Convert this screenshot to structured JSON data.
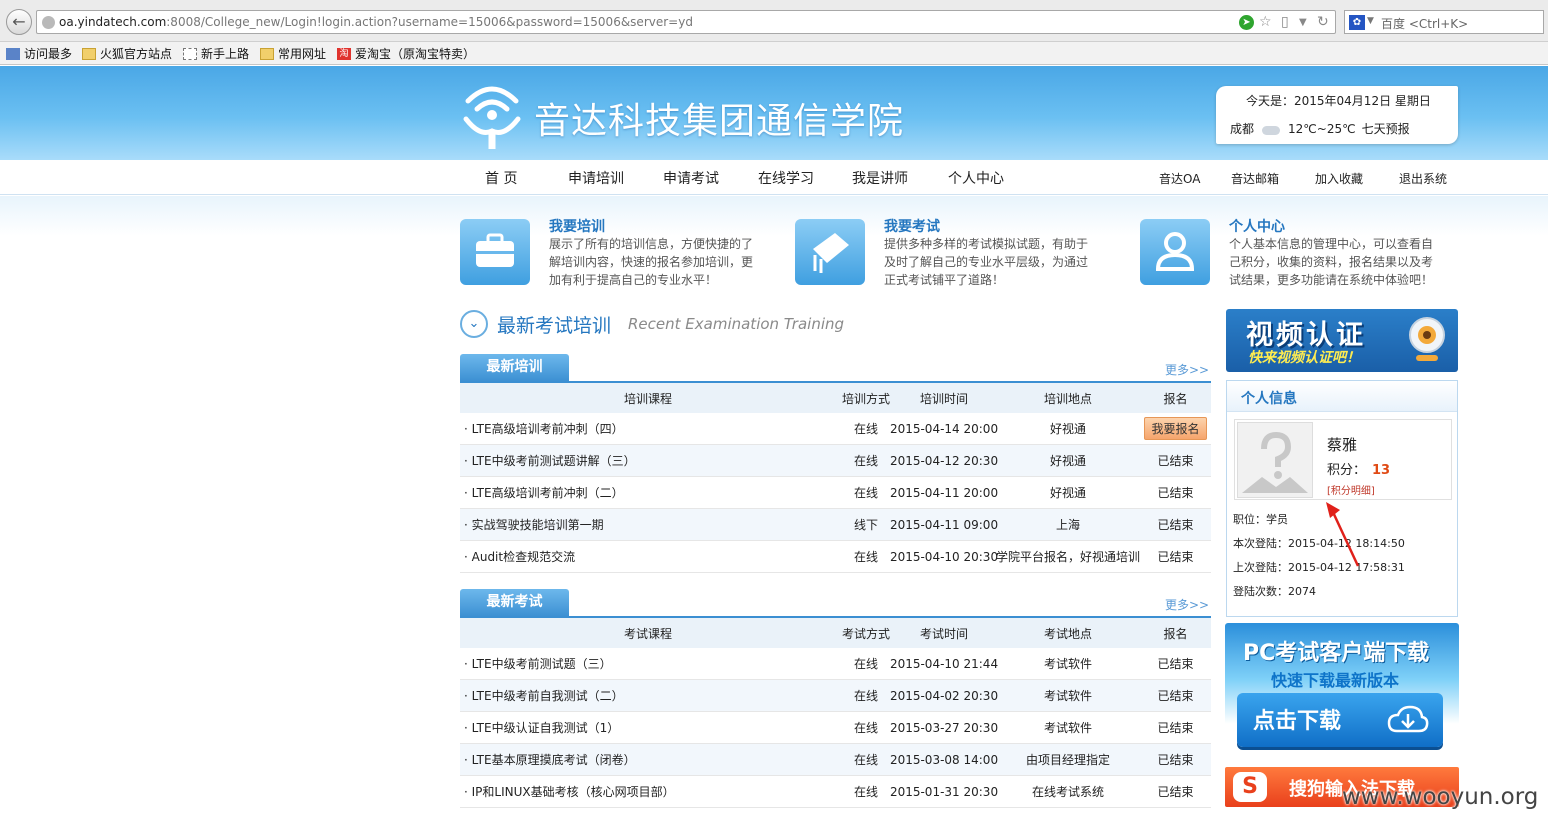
{
  "browser": {
    "url_domain": "oa.yindatech.com",
    "url_rest": ":8008/College_new/Login!login.action?username=15006&password=15006&server=yd",
    "search_placeholder": "百度 <Ctrl+K>",
    "bookmarks": [
      "访问最多",
      "火狐官方站点",
      "新手上路",
      "常用网址",
      "爱淘宝（原淘宝特卖）"
    ]
  },
  "header": {
    "site_title": "音达科技集团通信学院",
    "weather": {
      "date_line": "今天是：2015年04月12日 星期日",
      "city": "成都",
      "temp": "12℃~25℃",
      "forecast_link": "七天预报"
    }
  },
  "nav": {
    "main": [
      "首 页",
      "申请培训",
      "申请考试",
      "在线学习",
      "我是讲师",
      "个人中心"
    ],
    "sub": [
      "音达OA",
      "音达邮箱",
      "加入收藏",
      "退出系统"
    ]
  },
  "features": [
    {
      "title": "我要培训",
      "desc": "展示了所有的培训信息，方便快捷的了解培训内容，快速的报名参加培训，更加有利于提高自己的专业水平！"
    },
    {
      "title": "我要考试",
      "desc": "提供多种多样的考试模拟试题，有助于及时了解自己的专业水平层级，为通过正式考试铺平了道路！"
    },
    {
      "title": "个人中心",
      "desc": "个人基本信息的管理中心，可以查看自己积分，收集的资料，报名结果以及考试结果，更多功能请在系统中体验吧！"
    }
  ],
  "section": {
    "title": "最新考试培训",
    "subtitle": "Recent Examination Training"
  },
  "training": {
    "tab": "最新培训",
    "more": "更多>>",
    "headers": [
      "培训课程",
      "培训方式",
      "培训时间",
      "培训地点",
      "报名"
    ],
    "rows": [
      {
        "course": "· LTE高级培训考前冲刺（四）",
        "mode": "在线",
        "time": "2015-04-14 20:00",
        "place": "好视通",
        "action": "我要报名"
      },
      {
        "course": "· LTE中级考前测试题讲解（三）",
        "mode": "在线",
        "time": "2015-04-12 20:30",
        "place": "好视通",
        "action": "已结束"
      },
      {
        "course": "· LTE高级培训考前冲刺（二）",
        "mode": "在线",
        "time": "2015-04-11 20:00",
        "place": "好视通",
        "action": "已结束"
      },
      {
        "course": "· 实战驾驶技能培训第一期",
        "mode": "线下",
        "time": "2015-04-11 09:00",
        "place": "上海",
        "action": "已结束"
      },
      {
        "course": "· Audit检查规范交流",
        "mode": "在线",
        "time": "2015-04-10 20:30",
        "place": "学院平台报名，好视通培训",
        "action": "已结束"
      }
    ]
  },
  "exams": {
    "tab": "最新考试",
    "more": "更多>>",
    "headers": [
      "考试课程",
      "考试方式",
      "考试时间",
      "考试地点",
      "报名"
    ],
    "rows": [
      {
        "course": "· LTE中级考前测试题（三）",
        "mode": "在线",
        "time": "2015-04-10 21:44",
        "place": "考试软件",
        "action": "已结束"
      },
      {
        "course": "· LTE中级考前自我测试（二）",
        "mode": "在线",
        "time": "2015-04-02 20:30",
        "place": "考试软件",
        "action": "已结束"
      },
      {
        "course": "· LTE中级认证自我测试（1）",
        "mode": "在线",
        "time": "2015-03-27 20:30",
        "place": "考试软件",
        "action": "已结束"
      },
      {
        "course": "· LTE基本原理摸底考试（闭卷）",
        "mode": "在线",
        "time": "2015-03-08 14:00",
        "place": "由项目经理指定",
        "action": "已结束"
      },
      {
        "course": "· IP和LINUX基础考核（核心网项目部）",
        "mode": "在线",
        "time": "2015-01-31 20:30",
        "place": "在线考试系统",
        "action": "已结束"
      }
    ]
  },
  "sidebar": {
    "video_title": "视频认证",
    "video_sub": "快来视频认证吧！",
    "panel_title": "个人信息",
    "user_name": "蔡雅",
    "score_label": "积分：",
    "score": "13",
    "score_link": "[积分明细]",
    "position": "职位：学员",
    "this_login": "本次登陆：2015-04-12 18:14:50",
    "last_login": "上次登陆：2015-04-12 17:58:31",
    "login_count": "登陆次数：2074",
    "pc_title": "PC考试客户端下载",
    "pc_sub": "快速下载最新版本",
    "download_label": "点击下载",
    "sogou_label": "搜狗输入法下载"
  },
  "watermark": "www.wooyun.org",
  "colors": {
    "accent": "#2577c0",
    "banner": "#4aa7e6",
    "signup": "#f6a56c"
  }
}
